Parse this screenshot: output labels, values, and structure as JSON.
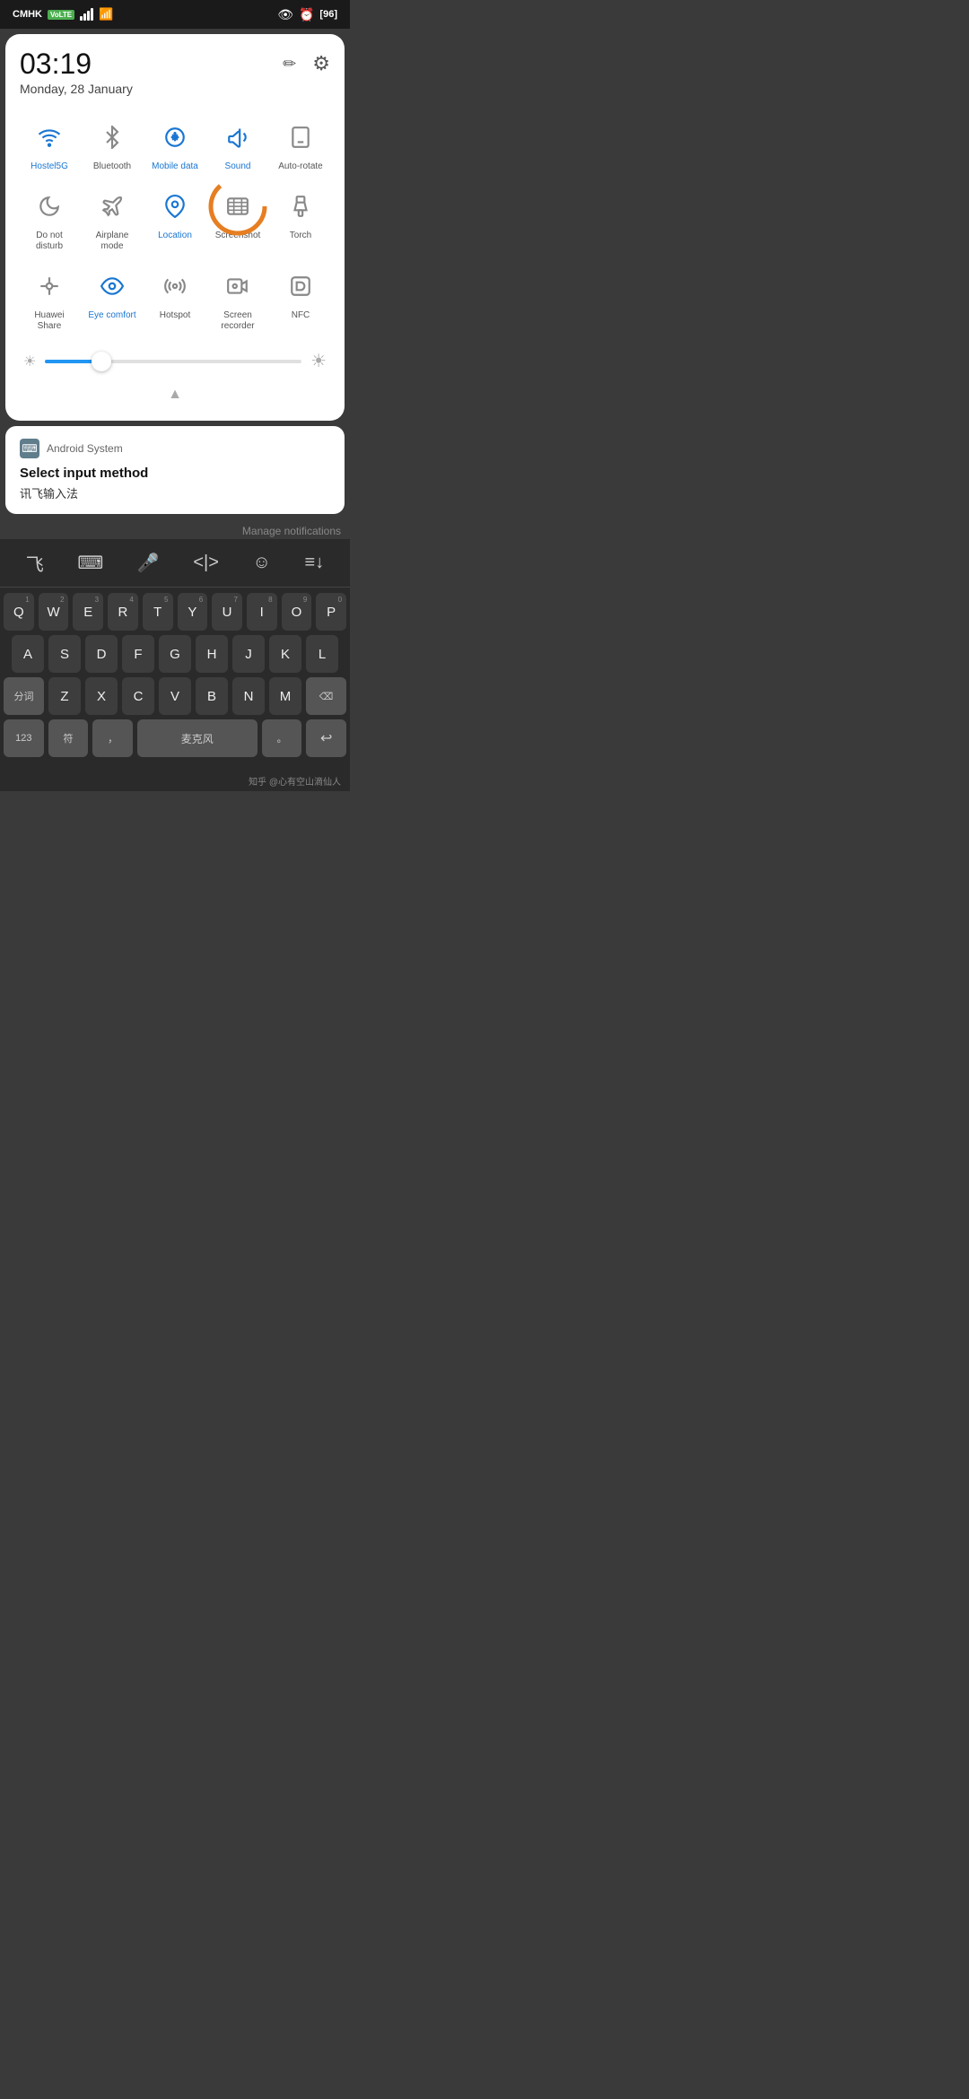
{
  "statusBar": {
    "carrier": "CMHK",
    "batteryPercent": "96",
    "time": "03:19",
    "date": "Monday, 28 January"
  },
  "quickSettings": {
    "editLabel": "✏",
    "settingsLabel": "⚙",
    "toggles": [
      {
        "id": "wifi",
        "label": "Hostel5G",
        "active": true,
        "icon": "wifi"
      },
      {
        "id": "bluetooth",
        "label": "Bluetooth",
        "active": false,
        "icon": "bluetooth"
      },
      {
        "id": "mobile-data",
        "label": "Mobile data",
        "active": true,
        "icon": "mobile-data"
      },
      {
        "id": "sound",
        "label": "Sound",
        "active": true,
        "icon": "sound"
      },
      {
        "id": "auto-rotate",
        "label": "Auto-rotate",
        "active": false,
        "icon": "auto-rotate"
      },
      {
        "id": "do-not-disturb",
        "label": "Do not disturb",
        "active": false,
        "icon": "moon"
      },
      {
        "id": "airplane",
        "label": "Airplane mode",
        "active": false,
        "icon": "airplane"
      },
      {
        "id": "location",
        "label": "Location",
        "active": true,
        "icon": "location"
      },
      {
        "id": "screenshot",
        "label": "Screenshot",
        "active": false,
        "icon": "screenshot"
      },
      {
        "id": "torch",
        "label": "Torch",
        "active": false,
        "icon": "torch"
      },
      {
        "id": "huawei-share",
        "label": "Huawei Share",
        "active": false,
        "icon": "huawei-share"
      },
      {
        "id": "eye-comfort",
        "label": "Eye comfort",
        "active": true,
        "icon": "eye"
      },
      {
        "id": "hotspot",
        "label": "Hotspot",
        "active": false,
        "icon": "hotspot"
      },
      {
        "id": "screen-recorder",
        "label": "Screen recorder",
        "active": false,
        "icon": "screen-recorder"
      },
      {
        "id": "nfc",
        "label": "NFC",
        "active": false,
        "icon": "nfc"
      }
    ],
    "brightness": 22
  },
  "notification": {
    "appIcon": "⌨",
    "appName": "Android System",
    "title": "Select input method",
    "subtitle": "讯飞输入法"
  },
  "manageNotifications": "Manage notifications",
  "keyboardToolbar": [
    "飞",
    "⌨",
    "🎤",
    "<|>",
    "☺",
    "≡↓"
  ],
  "keyboard": {
    "rows": [
      [
        "Q",
        "W",
        "E",
        "R",
        "T",
        "Y",
        "U",
        "I",
        "O",
        "P"
      ],
      [
        "A",
        "S",
        "D",
        "F",
        "G",
        "H",
        "J",
        "K",
        "L"
      ],
      [
        "分词",
        "Z",
        "X",
        "C",
        "V",
        "B",
        "N",
        "M",
        "⌫"
      ],
      [
        "123",
        "符",
        ",",
        "",
        "。",
        "↩"
      ]
    ],
    "numbers": [
      "1",
      "2",
      "3",
      "4",
      "5",
      "6",
      "7",
      "8",
      "9",
      "0"
    ]
  },
  "footer": "知乎 @心有空山滴仙人"
}
